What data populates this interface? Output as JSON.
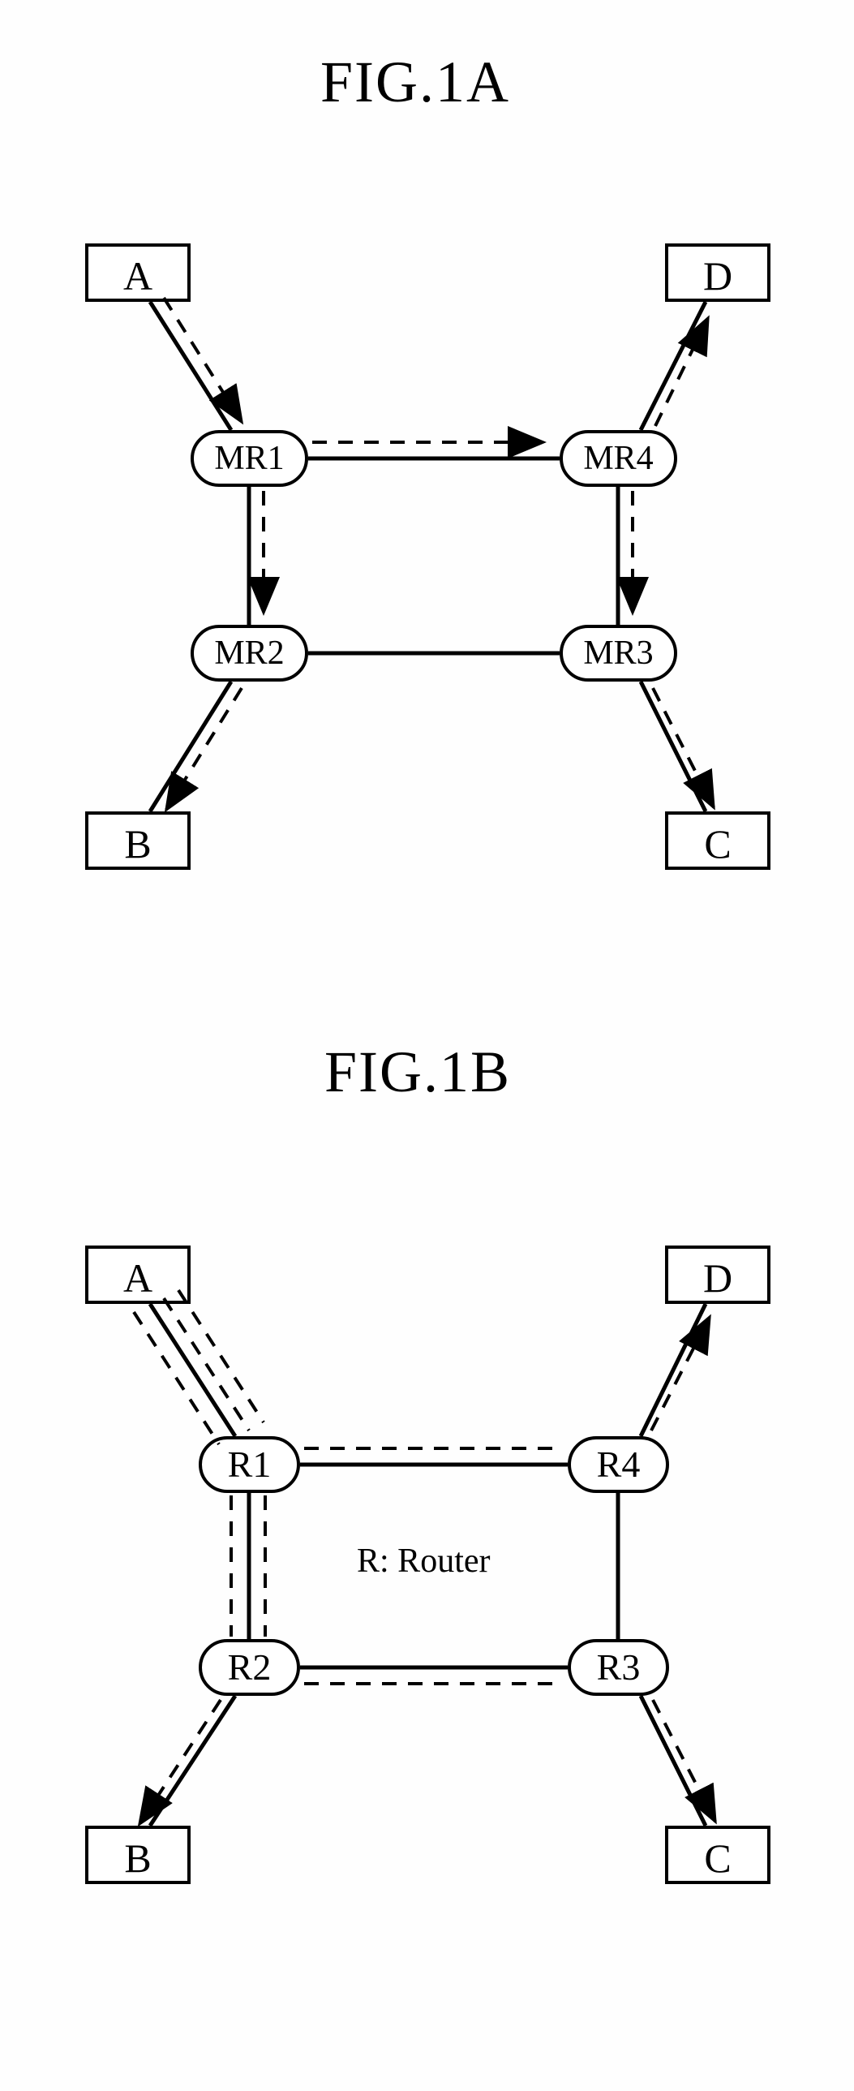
{
  "figures": {
    "a": "FIG.1A",
    "b": "FIG.1B"
  },
  "hosts": {
    "A": "A",
    "B": "B",
    "C": "C",
    "D": "D"
  },
  "routersA": {
    "mr1": "MR1",
    "mr2": "MR2",
    "mr3": "MR3",
    "mr4": "MR4"
  },
  "routersB": {
    "r1": "R1",
    "r2": "R2",
    "r3": "R3",
    "r4": "R4"
  },
  "label": {
    "router": "R: Router"
  },
  "chart_data": [
    {
      "type": "diagram",
      "title": "FIG.1A",
      "nodes": [
        {
          "id": "A",
          "kind": "host"
        },
        {
          "id": "B",
          "kind": "host"
        },
        {
          "id": "C",
          "kind": "host"
        },
        {
          "id": "D",
          "kind": "host"
        },
        {
          "id": "MR1",
          "kind": "multicast-router"
        },
        {
          "id": "MR2",
          "kind": "multicast-router"
        },
        {
          "id": "MR3",
          "kind": "multicast-router"
        },
        {
          "id": "MR4",
          "kind": "multicast-router"
        }
      ],
      "links_physical": [
        [
          "A",
          "MR1"
        ],
        [
          "MR1",
          "MR4"
        ],
        [
          "MR4",
          "D"
        ],
        [
          "MR1",
          "MR2"
        ],
        [
          "MR4",
          "MR3"
        ],
        [
          "MR2",
          "MR3"
        ],
        [
          "MR2",
          "B"
        ],
        [
          "MR3",
          "C"
        ]
      ],
      "multicast_tree_arrows": [
        [
          "A",
          "MR1"
        ],
        [
          "MR1",
          "MR4"
        ],
        [
          "MR1",
          "MR2"
        ],
        [
          "MR4",
          "D"
        ],
        [
          "MR4",
          "MR3"
        ],
        [
          "MR2",
          "B"
        ],
        [
          "MR3",
          "C"
        ]
      ]
    },
    {
      "type": "diagram",
      "title": "FIG.1B",
      "note": "R: Router",
      "nodes": [
        {
          "id": "A",
          "kind": "host"
        },
        {
          "id": "B",
          "kind": "host"
        },
        {
          "id": "C",
          "kind": "host"
        },
        {
          "id": "D",
          "kind": "host"
        },
        {
          "id": "R1",
          "kind": "router"
        },
        {
          "id": "R2",
          "kind": "router"
        },
        {
          "id": "R3",
          "kind": "router"
        },
        {
          "id": "R4",
          "kind": "router"
        }
      ],
      "links_physical": [
        [
          "A",
          "R1"
        ],
        [
          "R1",
          "R4"
        ],
        [
          "R4",
          "D"
        ],
        [
          "R1",
          "R2"
        ],
        [
          "R4",
          "R3"
        ],
        [
          "R2",
          "R3"
        ],
        [
          "R2",
          "B"
        ],
        [
          "R3",
          "C"
        ]
      ],
      "unicast_paths": [
        {
          "dst": "B",
          "hops": [
            "A",
            "R1",
            "R2",
            "B"
          ]
        },
        {
          "dst": "C",
          "hops": [
            "A",
            "R1",
            "R2",
            "R3",
            "C"
          ]
        },
        {
          "dst": "D",
          "hops": [
            "A",
            "R1",
            "R4",
            "D"
          ]
        }
      ]
    }
  ]
}
